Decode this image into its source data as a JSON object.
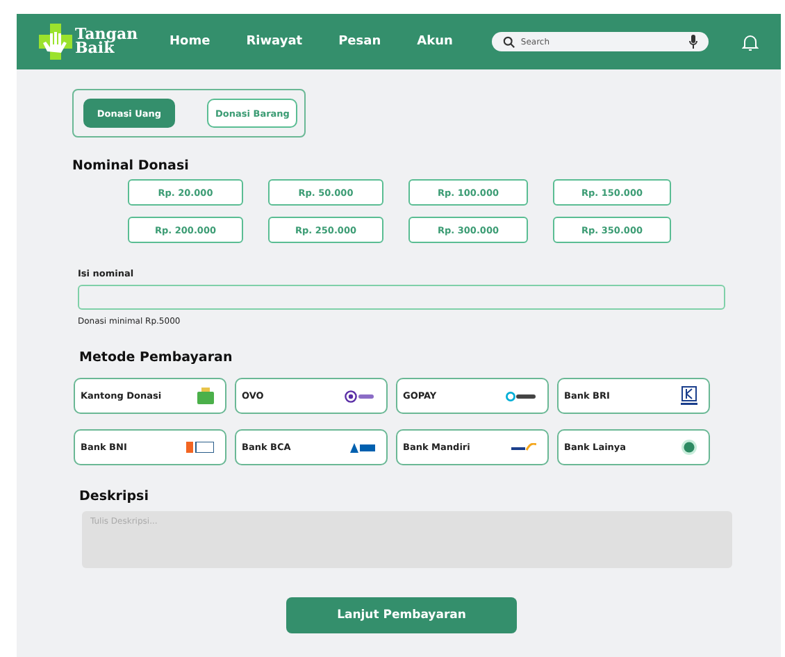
{
  "header": {
    "brand": [
      "Tangan",
      "Baik"
    ],
    "nav": [
      {
        "label": "Home"
      },
      {
        "label": "Riwayat"
      },
      {
        "label": "Pesan"
      },
      {
        "label": "Akun"
      }
    ],
    "search": {
      "placeholder": "Search"
    }
  },
  "tabs": [
    {
      "label": "Donasi Uang",
      "selected": true
    },
    {
      "label": "Donasi Barang",
      "selected": false
    }
  ],
  "nominal": {
    "title": "Nominal Donasi",
    "amounts": [
      "Rp. 20.000",
      "Rp. 50.000",
      "Rp. 100.000",
      "Rp. 150.000",
      "Rp. 200.000",
      "Rp. 250.000",
      "Rp. 300.000",
      "Rp. 350.000"
    ],
    "input_label": "Isi nominal",
    "hint": "Donasi minimal Rp.5000"
  },
  "payment": {
    "title": "Metode Pembayaran",
    "methods": [
      {
        "label": "Kantong Donasi",
        "kind": "wallet"
      },
      {
        "label": "OVO",
        "kind": "ovo"
      },
      {
        "label": "GOPAY",
        "kind": "gopay"
      },
      {
        "label": "Bank BRI",
        "kind": "bri"
      },
      {
        "label": "Bank BNI",
        "kind": "bni"
      },
      {
        "label": "Bank BCA",
        "kind": "bca"
      },
      {
        "label": "Bank Mandiri",
        "kind": "mandiri"
      },
      {
        "label": "Bank Lainya",
        "kind": "other"
      }
    ]
  },
  "description": {
    "title": "Deskripsi",
    "placeholder": "Tulis Deskripsi..."
  },
  "submit": "Lanjut Pembayaran"
}
